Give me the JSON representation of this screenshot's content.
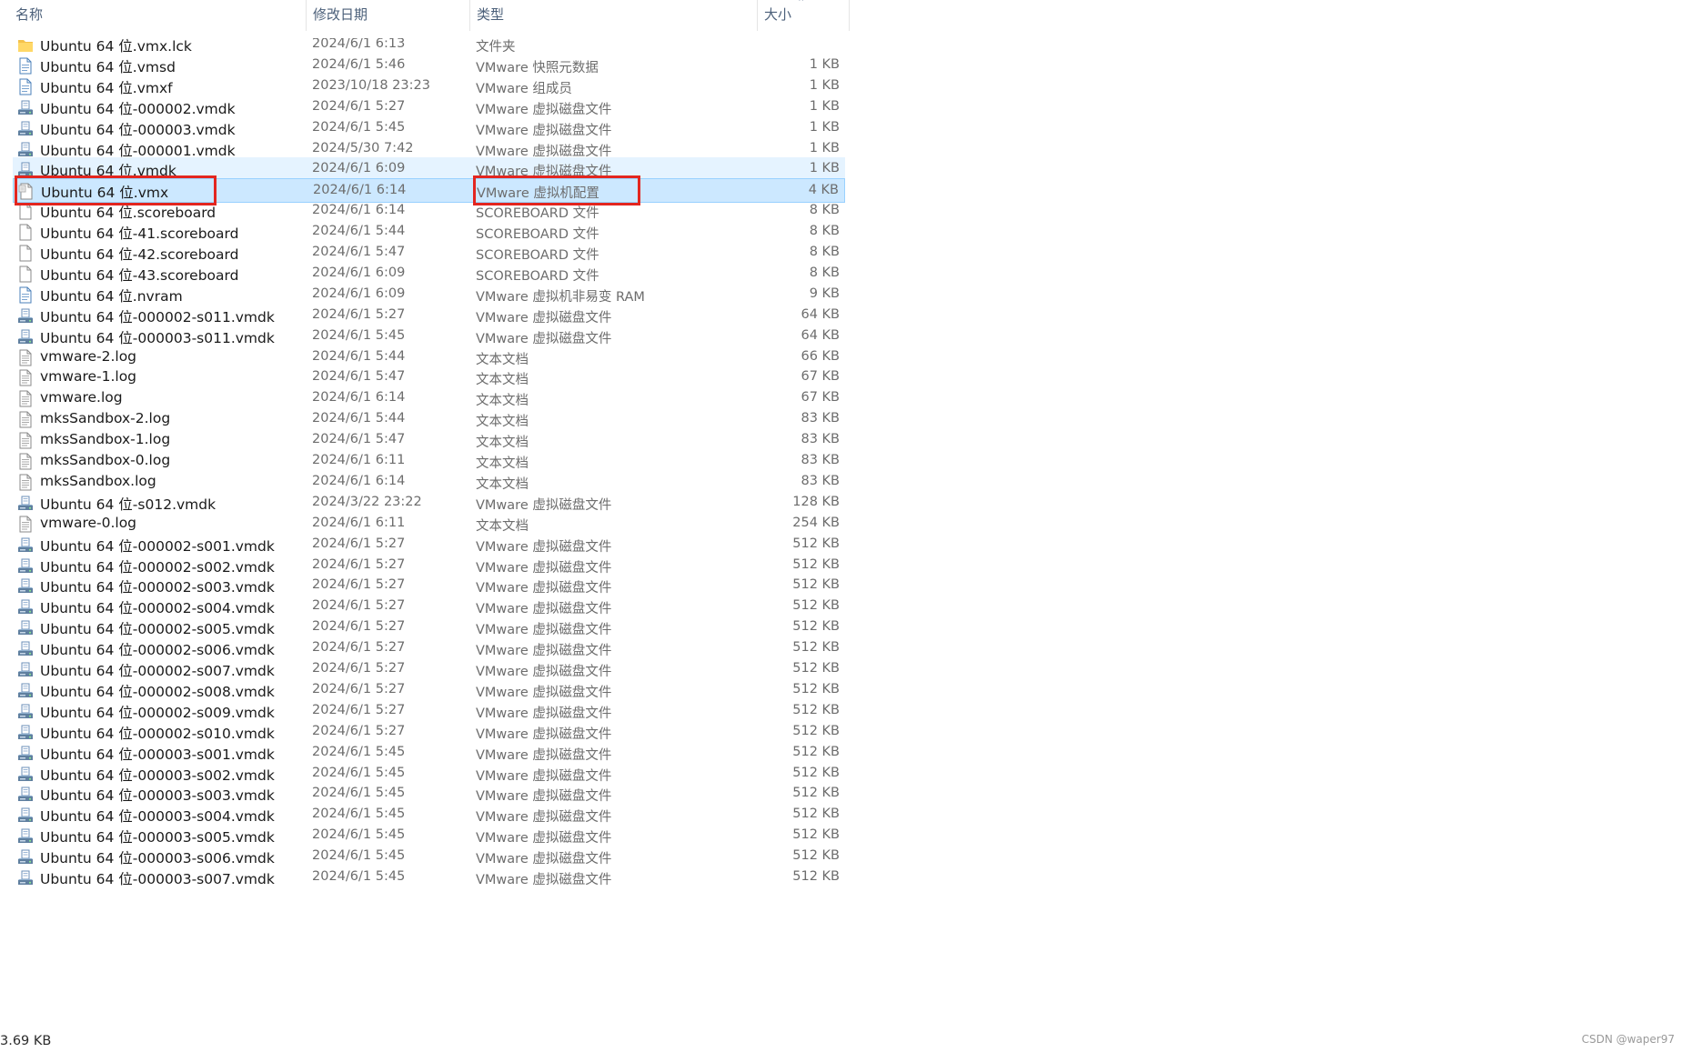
{
  "columns": {
    "name": "名称",
    "date": "修改日期",
    "type": "类型",
    "size": "大小"
  },
  "sort": {
    "column": "size",
    "direction": "ascending"
  },
  "files": [
    {
      "name": "Ubuntu 64 位.vmx.lck",
      "date": "2024/6/1 6:13",
      "type": "文件夹",
      "size": "",
      "icon": "folder-icon"
    },
    {
      "name": "Ubuntu 64 位.vmsd",
      "date": "2024/6/1 5:46",
      "type": "VMware 快照元数据",
      "size": "1 KB",
      "icon": "vmware-file-icon"
    },
    {
      "name": "Ubuntu 64 位.vmxf",
      "date": "2023/10/18 23:23",
      "type": "VMware 组成员",
      "size": "1 KB",
      "icon": "vmware-file-icon"
    },
    {
      "name": "Ubuntu 64 位-000002.vmdk",
      "date": "2024/6/1 5:27",
      "type": "VMware 虚拟磁盘文件",
      "size": "1 KB",
      "icon": "virtual-disk-icon"
    },
    {
      "name": "Ubuntu 64 位-000003.vmdk",
      "date": "2024/6/1 5:45",
      "type": "VMware 虚拟磁盘文件",
      "size": "1 KB",
      "icon": "virtual-disk-icon"
    },
    {
      "name": "Ubuntu 64 位-000001.vmdk",
      "date": "2024/5/30 7:42",
      "type": "VMware 虚拟磁盘文件",
      "size": "1 KB",
      "icon": "virtual-disk-icon"
    },
    {
      "name": "Ubuntu 64 位.vmdk",
      "date": "2024/6/1 6:09",
      "type": "VMware 虚拟磁盘文件",
      "size": "1 KB",
      "icon": "virtual-disk-icon",
      "state": "hover"
    },
    {
      "name": "Ubuntu 64 位.vmx",
      "date": "2024/6/1 6:14",
      "type": "VMware 虚拟机配置",
      "size": "4 KB",
      "icon": "vmx-config-icon",
      "state": "selected"
    },
    {
      "name": "Ubuntu 64 位.scoreboard",
      "date": "2024/6/1 6:14",
      "type": "SCOREBOARD 文件",
      "size": "8 KB",
      "icon": "blank-file-icon"
    },
    {
      "name": "Ubuntu 64 位-41.scoreboard",
      "date": "2024/6/1 5:44",
      "type": "SCOREBOARD 文件",
      "size": "8 KB",
      "icon": "blank-file-icon"
    },
    {
      "name": "Ubuntu 64 位-42.scoreboard",
      "date": "2024/6/1 5:47",
      "type": "SCOREBOARD 文件",
      "size": "8 KB",
      "icon": "blank-file-icon"
    },
    {
      "name": "Ubuntu 64 位-43.scoreboard",
      "date": "2024/6/1 6:09",
      "type": "SCOREBOARD 文件",
      "size": "8 KB",
      "icon": "blank-file-icon"
    },
    {
      "name": "Ubuntu 64 位.nvram",
      "date": "2024/6/1 6:09",
      "type": "VMware 虚拟机非易变 RAM",
      "size": "9 KB",
      "icon": "vmware-file-icon"
    },
    {
      "name": "Ubuntu 64 位-000002-s011.vmdk",
      "date": "2024/6/1 5:27",
      "type": "VMware 虚拟磁盘文件",
      "size": "64 KB",
      "icon": "virtual-disk-icon"
    },
    {
      "name": "Ubuntu 64 位-000003-s011.vmdk",
      "date": "2024/6/1 5:45",
      "type": "VMware 虚拟磁盘文件",
      "size": "64 KB",
      "icon": "virtual-disk-icon"
    },
    {
      "name": "vmware-2.log",
      "date": "2024/6/1 5:44",
      "type": "文本文档",
      "size": "66 KB",
      "icon": "text-file-icon"
    },
    {
      "name": "vmware-1.log",
      "date": "2024/6/1 5:47",
      "type": "文本文档",
      "size": "67 KB",
      "icon": "text-file-icon"
    },
    {
      "name": "vmware.log",
      "date": "2024/6/1 6:14",
      "type": "文本文档",
      "size": "67 KB",
      "icon": "text-file-icon"
    },
    {
      "name": "mksSandbox-2.log",
      "date": "2024/6/1 5:44",
      "type": "文本文档",
      "size": "83 KB",
      "icon": "text-file-icon"
    },
    {
      "name": "mksSandbox-1.log",
      "date": "2024/6/1 5:47",
      "type": "文本文档",
      "size": "83 KB",
      "icon": "text-file-icon"
    },
    {
      "name": "mksSandbox-0.log",
      "date": "2024/6/1 6:11",
      "type": "文本文档",
      "size": "83 KB",
      "icon": "text-file-icon"
    },
    {
      "name": "mksSandbox.log",
      "date": "2024/6/1 6:14",
      "type": "文本文档",
      "size": "83 KB",
      "icon": "text-file-icon"
    },
    {
      "name": "Ubuntu 64 位-s012.vmdk",
      "date": "2024/3/22 23:22",
      "type": "VMware 虚拟磁盘文件",
      "size": "128 KB",
      "icon": "virtual-disk-icon"
    },
    {
      "name": "vmware-0.log",
      "date": "2024/6/1 6:11",
      "type": "文本文档",
      "size": "254 KB",
      "icon": "text-file-icon"
    },
    {
      "name": "Ubuntu 64 位-000002-s001.vmdk",
      "date": "2024/6/1 5:27",
      "type": "VMware 虚拟磁盘文件",
      "size": "512 KB",
      "icon": "virtual-disk-icon"
    },
    {
      "name": "Ubuntu 64 位-000002-s002.vmdk",
      "date": "2024/6/1 5:27",
      "type": "VMware 虚拟磁盘文件",
      "size": "512 KB",
      "icon": "virtual-disk-icon"
    },
    {
      "name": "Ubuntu 64 位-000002-s003.vmdk",
      "date": "2024/6/1 5:27",
      "type": "VMware 虚拟磁盘文件",
      "size": "512 KB",
      "icon": "virtual-disk-icon"
    },
    {
      "name": "Ubuntu 64 位-000002-s004.vmdk",
      "date": "2024/6/1 5:27",
      "type": "VMware 虚拟磁盘文件",
      "size": "512 KB",
      "icon": "virtual-disk-icon"
    },
    {
      "name": "Ubuntu 64 位-000002-s005.vmdk",
      "date": "2024/6/1 5:27",
      "type": "VMware 虚拟磁盘文件",
      "size": "512 KB",
      "icon": "virtual-disk-icon"
    },
    {
      "name": "Ubuntu 64 位-000002-s006.vmdk",
      "date": "2024/6/1 5:27",
      "type": "VMware 虚拟磁盘文件",
      "size": "512 KB",
      "icon": "virtual-disk-icon"
    },
    {
      "name": "Ubuntu 64 位-000002-s007.vmdk",
      "date": "2024/6/1 5:27",
      "type": "VMware 虚拟磁盘文件",
      "size": "512 KB",
      "icon": "virtual-disk-icon"
    },
    {
      "name": "Ubuntu 64 位-000002-s008.vmdk",
      "date": "2024/6/1 5:27",
      "type": "VMware 虚拟磁盘文件",
      "size": "512 KB",
      "icon": "virtual-disk-icon"
    },
    {
      "name": "Ubuntu 64 位-000002-s009.vmdk",
      "date": "2024/6/1 5:27",
      "type": "VMware 虚拟磁盘文件",
      "size": "512 KB",
      "icon": "virtual-disk-icon"
    },
    {
      "name": "Ubuntu 64 位-000002-s010.vmdk",
      "date": "2024/6/1 5:27",
      "type": "VMware 虚拟磁盘文件",
      "size": "512 KB",
      "icon": "virtual-disk-icon"
    },
    {
      "name": "Ubuntu 64 位-000003-s001.vmdk",
      "date": "2024/6/1 5:45",
      "type": "VMware 虚拟磁盘文件",
      "size": "512 KB",
      "icon": "virtual-disk-icon"
    },
    {
      "name": "Ubuntu 64 位-000003-s002.vmdk",
      "date": "2024/6/1 5:45",
      "type": "VMware 虚拟磁盘文件",
      "size": "512 KB",
      "icon": "virtual-disk-icon"
    },
    {
      "name": "Ubuntu 64 位-000003-s003.vmdk",
      "date": "2024/6/1 5:45",
      "type": "VMware 虚拟磁盘文件",
      "size": "512 KB",
      "icon": "virtual-disk-icon"
    },
    {
      "name": "Ubuntu 64 位-000003-s004.vmdk",
      "date": "2024/6/1 5:45",
      "type": "VMware 虚拟磁盘文件",
      "size": "512 KB",
      "icon": "virtual-disk-icon"
    },
    {
      "name": "Ubuntu 64 位-000003-s005.vmdk",
      "date": "2024/6/1 5:45",
      "type": "VMware 虚拟磁盘文件",
      "size": "512 KB",
      "icon": "virtual-disk-icon"
    },
    {
      "name": "Ubuntu 64 位-000003-s006.vmdk",
      "date": "2024/6/1 5:45",
      "type": "VMware 虚拟磁盘文件",
      "size": "512 KB",
      "icon": "virtual-disk-icon"
    },
    {
      "name": "Ubuntu 64 位-000003-s007.vmdk",
      "date": "2024/6/1 5:45",
      "type": "VMware 虚拟磁盘文件",
      "size": "512 KB",
      "icon": "virtual-disk-icon"
    }
  ],
  "statusbar": {
    "selected_size": "3.69 KB"
  },
  "watermark": "CSDN @waper97",
  "colors": {
    "selected_bg": "#cce8ff",
    "selected_border": "#99d1ff",
    "hover_bg": "#e5f3ff",
    "annotation_red": "#e3261f",
    "header_text": "#4c607a"
  }
}
